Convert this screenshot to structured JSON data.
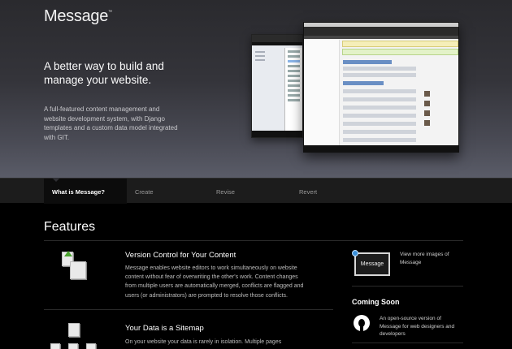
{
  "header": {
    "logo": "Message",
    "trademark": "™",
    "headline": "A better way to build and manage your website.",
    "blurb": "A full-featured content management and website development system, with Django templates and a custom data model integrated with GIT."
  },
  "nav": {
    "tabs": [
      {
        "label": "What is Message?",
        "active": true
      },
      {
        "label": "Create"
      },
      {
        "label": "Revise"
      },
      {
        "label": "Revert"
      }
    ]
  },
  "main": {
    "title": "Features",
    "features": [
      {
        "title": "Version Control for Your Content",
        "text": "Message enables website editors to work simultaneously on website content without fear of overwriting the other's work. Content changes from multiple users are automatically merged, conflicts are flagged and users (or administrators) are prompted to resolve those conflicts."
      },
      {
        "title": "Your Data is a Sitemap",
        "text": "On your website your data is rarely in isolation. Multiple pages"
      }
    ]
  },
  "sidebar": {
    "images_thumb_label": "Message",
    "images_link": "View more images of Message",
    "coming_soon_title": "Coming Soon",
    "coming_soon_text": "An open-source version of Message for web designers and developers"
  },
  "colors": {
    "accent_blue": "#3a8fd8",
    "arrow_green": "#4aa32f",
    "background": "#000000"
  }
}
